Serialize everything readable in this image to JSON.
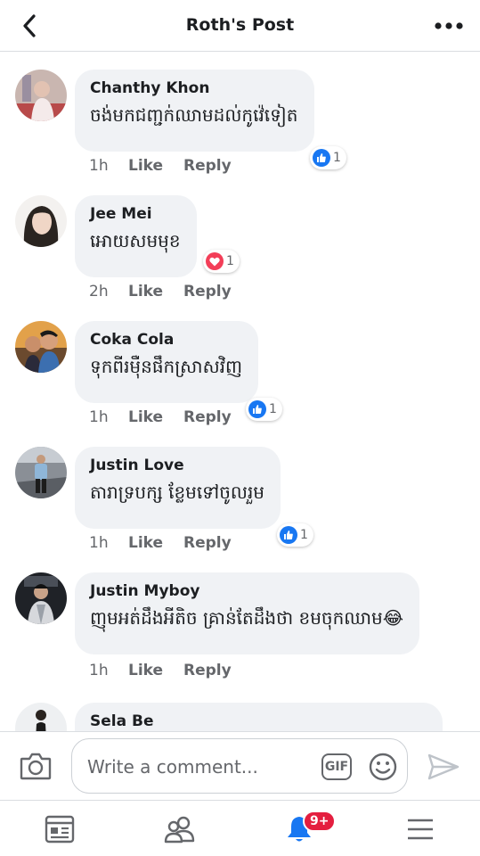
{
  "header": {
    "title": "Roth's Post"
  },
  "comments": [
    {
      "author": "Chanthy Khon",
      "text": "ចង់មកជញ្ជក់ឈាមដល់កូវ៉េទៀត",
      "time": "1h",
      "like_label": "Like",
      "reply_label": "Reply",
      "reaction": {
        "type": "like",
        "count": "1"
      }
    },
    {
      "author": "Jee Mei",
      "text": "អោយសមមុខ",
      "time": "2h",
      "like_label": "Like",
      "reply_label": "Reply",
      "reaction": {
        "type": "love",
        "count": "1"
      }
    },
    {
      "author": "Coka Cola",
      "text": "ទុកពីរម៉ឺនផឹកស្រាសវិញ",
      "time": "1h",
      "like_label": "Like",
      "reply_label": "Reply",
      "reaction": {
        "type": "like",
        "count": "1"
      }
    },
    {
      "author": "Justin Love",
      "text": "តារាទ្របក្ស ខ្លែមទៅចូលរួម",
      "time": "1h",
      "like_label": "Like",
      "reply_label": "Reply",
      "reaction": {
        "type": "like",
        "count": "1"
      }
    },
    {
      "author": "Justin Myboy",
      "text": "ញុមអត់ដឹងអីតិច គ្រាន់តែដឹងថា ខមចុកឈាម😂",
      "time": "1h",
      "like_label": "Like",
      "reply_label": "Reply"
    },
    {
      "author": "Sela Be"
    }
  ],
  "composer": {
    "placeholder": "Write a comment...",
    "gif_label": "GIF"
  },
  "tabbar": {
    "notifications_badge": "9+"
  },
  "colors": {
    "like_blue": "#1877f2",
    "love_red": "#f33e58",
    "badge_red": "#e41e3f",
    "bubble_gray": "#f0f2f5"
  }
}
